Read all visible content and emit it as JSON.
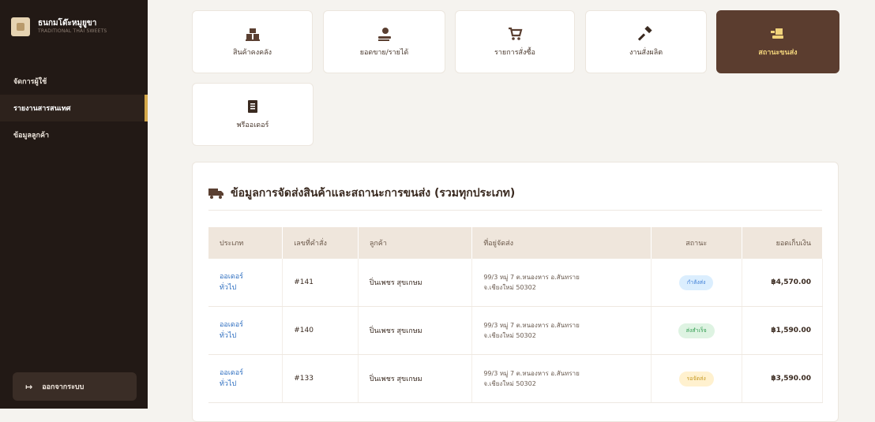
{
  "brand": {
    "title": "ธนกมโด๊ะหมูยูขา",
    "subtitle": "TRADITIONAL THAI SWEETS"
  },
  "sidebar": {
    "items": [
      {
        "label": "จัดการผู้ใช้"
      },
      {
        "label": "รายงานสารสนเทศ"
      },
      {
        "label": "ข้อมูลลูกค้า"
      }
    ],
    "logout_label": "ออกจากระบบ"
  },
  "cards": [
    {
      "label": "สินค้าคงคลัง",
      "icon": "boxes-icon"
    },
    {
      "label": "ยอดขาย/รายได้",
      "icon": "money-hand-icon"
    },
    {
      "label": "รายการสั่งซื้อ",
      "icon": "cart-icon"
    },
    {
      "label": "งานสั่งผลิต",
      "icon": "hammer-icon"
    },
    {
      "label": "สถานะขนส่ง",
      "icon": "delivery-icon"
    },
    {
      "label": "พรีออเดอร์",
      "icon": "document-icon"
    }
  ],
  "panel": {
    "title": "ข้อมูลการจัดส่งสินค้าและสถานะการขนส่ง (รวมทุกประเภท)",
    "columns": [
      "ประเภท",
      "เลขที่คำสั่ง",
      "ลูกค้า",
      "ที่อยู่จัดส่ง",
      "สถานะ",
      "ยอดเก็บเงิน"
    ],
    "rows": [
      {
        "type_line1": "ออเดอร์",
        "type_line2": "ทั่วไป",
        "order": "#141",
        "customer": "ปิ่นเพชร สุขเกษม",
        "addr1": "99/3 หมู่ 7 ต.หนองหาร อ.สันทราย",
        "addr2": "จ.เชียงใหม่ 50302",
        "status": "กำลังส่ง",
        "amount": "฿4,570.00"
      },
      {
        "type_line1": "ออเดอร์",
        "type_line2": "ทั่วไป",
        "order": "#140",
        "customer": "ปิ่นเพชร สุขเกษม",
        "addr1": "99/3 หมู่ 7 ต.หนองหาร อ.สันทราย",
        "addr2": "จ.เชียงใหม่ 50302",
        "status": "ส่งสำเร็จ",
        "amount": "฿1,590.00"
      },
      {
        "type_line1": "ออเดอร์",
        "type_line2": "ทั่วไป",
        "order": "#133",
        "customer": "ปิ่นเพชร สุขเกษม",
        "addr1": "99/3 หมู่ 7 ต.หนองหาร อ.สันทราย",
        "addr2": "จ.เชียงใหม่ 50302",
        "status": "รอจัดส่ง",
        "amount": "฿3,590.00"
      }
    ]
  },
  "colors": {
    "sidebar_bg": "#221915",
    "accent": "#d4a84a",
    "active_card": "#5b3d2f",
    "badge_blue_bg": "#dbeefe",
    "badge_blue_fg": "#3a7bd5",
    "badge_green_bg": "#def3e2",
    "badge_green_fg": "#2e9b4e",
    "badge_yellow_bg": "#fff1cf",
    "badge_yellow_fg": "#c79a24"
  }
}
